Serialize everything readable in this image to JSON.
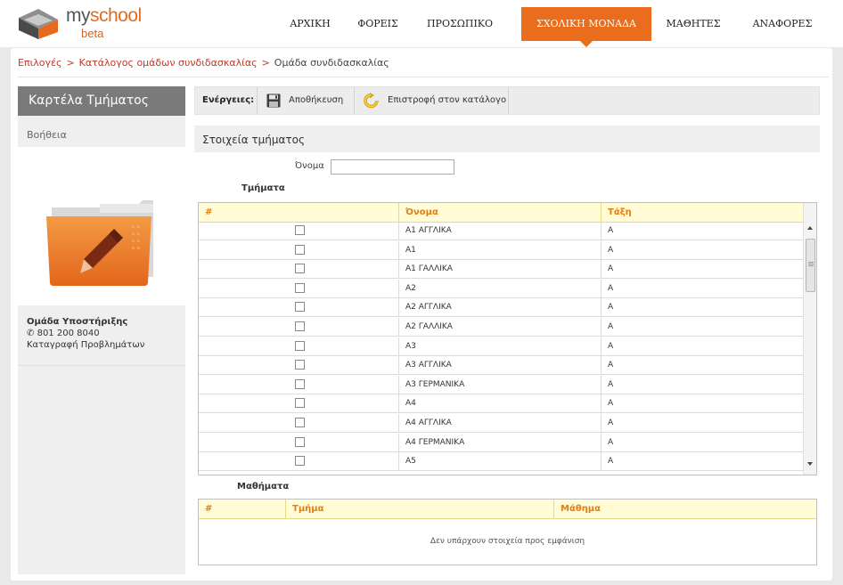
{
  "brand": {
    "name_prefix": "my",
    "name_suffix": "school",
    "tagline": "beta"
  },
  "nav": [
    {
      "label": "ΑΡΧΙΚΗ",
      "active": false
    },
    {
      "label": "ΦΟΡΕΙΣ",
      "active": false
    },
    {
      "label": "ΠΡΟΣΩΠΙΚΟ",
      "active": false
    },
    {
      "label": "ΣΧΟΛΙΚΗ ΜΟΝΑΔΑ",
      "active": true
    },
    {
      "label": "ΜΑΘΗΤΕΣ",
      "active": false
    },
    {
      "label": "ΑΝΑΦΟΡΕΣ",
      "active": false
    }
  ],
  "breadcrumb": {
    "items": [
      "Επιλογές",
      "Κατάλογος ομάδων συνδιδασκαλίας",
      "Ομάδα συνδιδασκαλίας"
    ],
    "separator": ">"
  },
  "sidebar": {
    "title": "Καρτέλα Τμήματος",
    "help": "Βοήθεια",
    "support": {
      "title": "Ομάδα Υποστήριξης",
      "phone": "801 200 8040",
      "link": "Καταγραφή Προβλημάτων"
    }
  },
  "toolbar": {
    "label": "Ενέργειες:",
    "save": "Αποθήκευση",
    "back": "Επιστροφή στον κατάλογο"
  },
  "section": {
    "title": "Στοιχεία τμήματος",
    "name_label": "Όνομα",
    "name_value": ""
  },
  "sections_table": {
    "title": "Τμήματα",
    "columns": [
      "#",
      "Όνομα",
      "Τάξη"
    ],
    "rows": [
      {
        "name": "Α1 ΑΓΓΛΙΚΑ",
        "class": "Α",
        "checked": false
      },
      {
        "name": "Α1",
        "class": "Α",
        "checked": false
      },
      {
        "name": "Α1 ΓΑΛΛΙΚΑ",
        "class": "Α",
        "checked": false
      },
      {
        "name": "Α2",
        "class": "Α",
        "checked": false
      },
      {
        "name": "Α2 ΑΓΓΛΙΚΑ",
        "class": "Α",
        "checked": false
      },
      {
        "name": "Α2 ΓΑΛΛΙΚΑ",
        "class": "Α",
        "checked": false
      },
      {
        "name": "Α3",
        "class": "Α",
        "checked": false
      },
      {
        "name": "Α3 ΑΓΓΛΙΚΑ",
        "class": "Α",
        "checked": false
      },
      {
        "name": "Α3 ΓΕΡΜΑΝΙΚΑ",
        "class": "Α",
        "checked": false
      },
      {
        "name": "Α4",
        "class": "Α",
        "checked": false
      },
      {
        "name": "Α4 ΑΓΓΛΙΚΑ",
        "class": "Α",
        "checked": false
      },
      {
        "name": "Α4 ΓΕΡΜΑΝΙΚΑ",
        "class": "Α",
        "checked": false
      },
      {
        "name": "Α5",
        "class": "Α",
        "checked": false
      }
    ]
  },
  "courses_table": {
    "title": "Μαθήματα",
    "columns": [
      "#",
      "Τμήμα",
      "Μάθημα"
    ],
    "empty_message": "Δεν υπάρχουν στοιχεία προς εμφάνιση"
  },
  "colors": {
    "accent": "#e96d1c",
    "link": "#c0392b",
    "grid_header_text": "#e47d14",
    "grid_header_bg": "#fffcd6"
  },
  "icons": {
    "save": "floppy-disk-icon",
    "back": "return-arrow-icon",
    "phone": "phone-icon",
    "folder": "folder-edit-icon"
  }
}
